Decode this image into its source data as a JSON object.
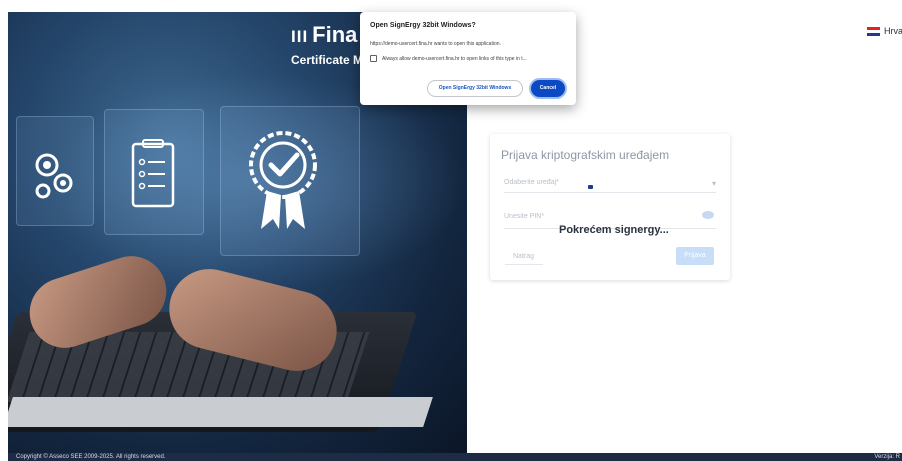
{
  "brand": {
    "bars": "III",
    "name": "Fina",
    "subtitle": "Certificate M"
  },
  "language": {
    "label": "Hrva",
    "flag_icon": "croatia-flag-icon"
  },
  "dialog": {
    "title": "Open SignErgy 32bit Windows?",
    "message": "https://demo-usercert.fina.hr wants to open this application.",
    "checkbox_label": "Always allow demo-usercert.fina.hr to open links of this type in t...",
    "open_label": "Open SignErgy 32bit Windows",
    "cancel_label": "Cancel"
  },
  "login": {
    "title": "Prijava kriptografskim uređajem",
    "device_placeholder": "Odaberite uređaj*",
    "pin_placeholder": "Unesite PIN*",
    "back_label": "Natrag",
    "submit_label": "Prijava",
    "loading_text": "Pokrećem signergy..."
  },
  "footer": {
    "copyright": "Copyright © Asseco SEE 2009-2025. All rights reserved.",
    "version": "Verzija: R"
  },
  "colors": {
    "footer_bg": "#1d2b45",
    "primary": "#0b4ac2",
    "submit_disabled": "#c7ddf8"
  }
}
